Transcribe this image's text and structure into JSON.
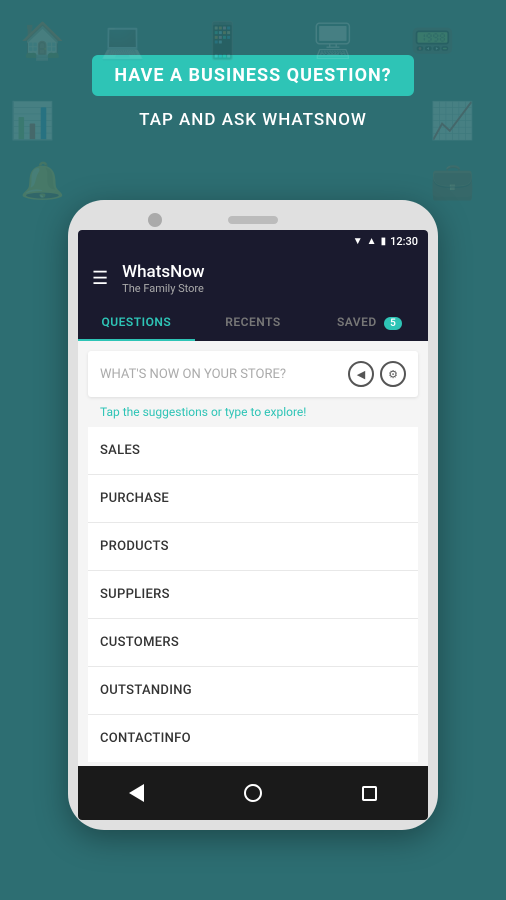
{
  "background": {
    "color": "#2d6e72"
  },
  "header": {
    "banner_text": "HAVE A BUSINESS QUESTION?",
    "subtitle": "TAP AND ASK WHATSNOW"
  },
  "phone": {
    "status_bar": {
      "time": "12:30",
      "signal": "▼",
      "wifi": "▲",
      "battery": "▮"
    },
    "toolbar": {
      "menu_icon": "☰",
      "app_name": "WhatsNow",
      "store_name": "The Family Store"
    },
    "tabs": [
      {
        "label": "QUESTIONS",
        "active": true,
        "badge": null
      },
      {
        "label": "RECENTS",
        "active": false,
        "badge": null
      },
      {
        "label": "SAVED",
        "active": false,
        "badge": "5"
      }
    ],
    "search": {
      "placeholder": "WHAT'S NOW ON YOUR STORE?",
      "suggestion": "Tap the suggestions or type to explore!"
    },
    "list_items": [
      {
        "label": "SALES"
      },
      {
        "label": "PURCHASE"
      },
      {
        "label": "PRODUCTS"
      },
      {
        "label": "SUPPLIERS"
      },
      {
        "label": "CUSTOMERS"
      },
      {
        "label": "OUTSTANDING"
      },
      {
        "label": "CONTACTINFO"
      }
    ],
    "bottom_nav": {
      "back_label": "back",
      "home_label": "home",
      "recent_label": "recent"
    }
  }
}
